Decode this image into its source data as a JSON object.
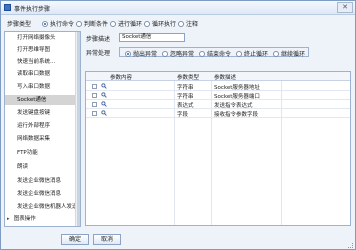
{
  "window": {
    "title": "事件执行步骤",
    "close_glyph": "✕"
  },
  "step_type": {
    "label": "步骤类型",
    "options": [
      {
        "label": "执行命令",
        "selected": true
      },
      {
        "label": "判断条件",
        "selected": false
      },
      {
        "label": "进行循环",
        "selected": false
      },
      {
        "label": "循环执行",
        "selected": false
      },
      {
        "label": "注释",
        "selected": false
      }
    ]
  },
  "sidebar": {
    "items": [
      {
        "label": "打开网络摄像头",
        "selected": false
      },
      {
        "label": "打开思维导图",
        "selected": false
      },
      {
        "label": "快速当前系统...",
        "selected": false
      },
      {
        "label": "读取串口数据",
        "selected": false
      },
      {
        "label": "写入串口数据",
        "selected": false
      },
      {
        "label": "Socket通信",
        "selected": true
      },
      {
        "label": "发送键盘按键",
        "selected": false
      },
      {
        "label": "运行外部程序",
        "selected": false
      },
      {
        "label": "网络数据采集",
        "selected": false
      },
      {
        "label": "FTP功能",
        "selected": false
      },
      {
        "label": "朗读",
        "selected": false
      },
      {
        "label": "发送企业微信消息",
        "selected": false
      },
      {
        "label": "发送企业微信消息",
        "selected": false
      },
      {
        "label": "发送企业微信机器人发送...",
        "selected": false
      }
    ],
    "group": {
      "expander": "▸",
      "label": "图表操作"
    }
  },
  "form": {
    "step_desc_label": "步骤描述",
    "step_desc_value": "Socket通信",
    "error_label": "异常处理",
    "error_options": [
      {
        "label": "抛出异常",
        "selected": true
      },
      {
        "label": "忽略异常",
        "selected": false
      },
      {
        "label": "结束命令",
        "selected": false
      },
      {
        "label": "终止循环",
        "selected": false
      },
      {
        "label": "继续循环",
        "selected": false
      }
    ]
  },
  "grid": {
    "headers": [
      "参数内容",
      "参数类型",
      "参数描述"
    ],
    "rows": [
      {
        "content": "",
        "type": "字符串",
        "desc": "Socket服务器地址"
      },
      {
        "content": "",
        "type": "字符串",
        "desc": "Socket服务器端口"
      },
      {
        "content": "",
        "type": "表达式",
        "desc": "发送指令表达式"
      },
      {
        "content": "",
        "type": "字段",
        "desc": "接收指令参数字段"
      }
    ]
  },
  "footer": {
    "ok_label": "确定",
    "cancel_label": "取消"
  },
  "colors": {
    "accent": "#2a5fb3",
    "border": "#9cb2d0",
    "selected_row": "#d4d4d4"
  }
}
